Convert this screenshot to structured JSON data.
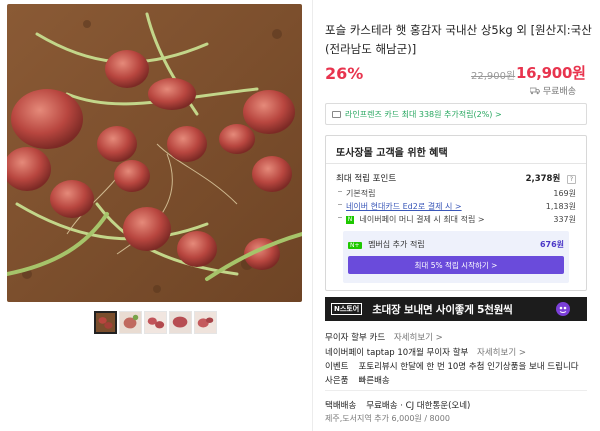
{
  "product": {
    "title": "포슬 카스테라 햇 홍감자 국내산 상5kg 외 [원산지:국산(전라남도 해남군)]",
    "discount": "26%",
    "original_price": "22,900원",
    "sale_price": "16,900원",
    "shipping": "무료배송"
  },
  "card_banner": "라인프렌즈 카드 최대 338원 추가적립(2%) >",
  "benefits": {
    "heading": "또사장몰 고객을 위한 혜택",
    "max_points_label": "최대 적립 포인트",
    "max_points_value": "2,378원",
    "help_icon": "?",
    "rows": [
      {
        "label": "기본적립",
        "value": "169원"
      },
      {
        "label": "네이버 현대카드 Ed2로 결제 시 >",
        "value": "1,183원"
      },
      {
        "label": "네이버페이 머니 결제 시 최대 적립 >",
        "value": "337원"
      }
    ],
    "membership": {
      "badge": "N+",
      "label": "멤버십 추가 적립",
      "value": "676원",
      "button": "최대 5% 적립 시작하기 >"
    }
  },
  "ad": {
    "logo": "N스토어",
    "text": "초대장 보내면 사이좋게 5천원씩"
  },
  "info": {
    "row1_label": "무이자 할부 카드",
    "row1_sub": "자세히보기 >",
    "row2_label": "네이버페이 taptap 10개월 무이자 할부",
    "row2_sub": "자세히보기 >",
    "row3_label": "이벤트",
    "row3_text": "포토리뷰시 한달에 한 번 10명 추첨 인기상품을 보내 드립니다",
    "row4_label": "사은품",
    "row4_text": "빠른배송",
    "row5_label": "택배배송",
    "row5_text": "무료배송 · CJ 대한통운(오네)",
    "row6_text": "제주,도서지역 추가 6,000원 / 8000"
  },
  "colors": {
    "accent_red": "#e8344e",
    "membership_purple": "#6a4bdb",
    "naver_green": "#1ec800"
  },
  "icons": {
    "shipping": "truck-icon",
    "card": "card-icon",
    "help": "question-icon"
  }
}
